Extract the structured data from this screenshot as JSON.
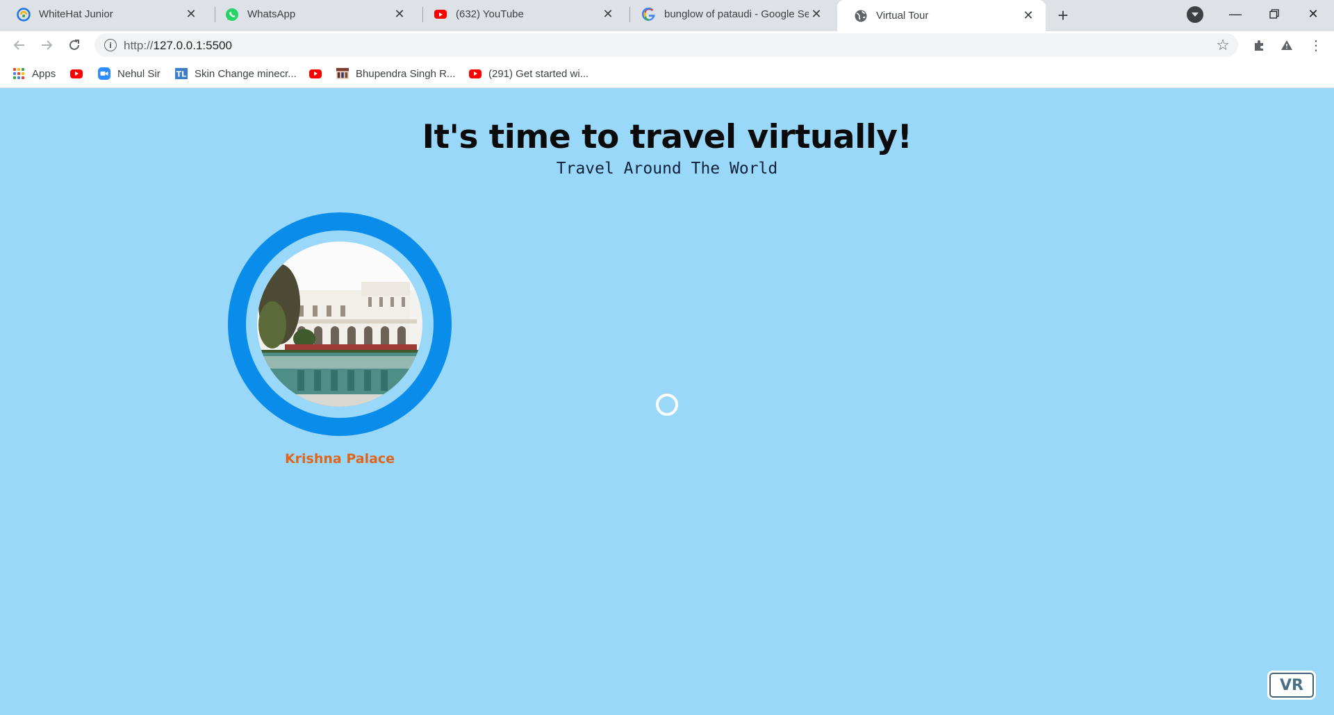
{
  "browser": {
    "tabs": [
      {
        "title": "WhiteHat Junior",
        "icon": "whitehat-icon"
      },
      {
        "title": "WhatsApp",
        "icon": "whatsapp-icon"
      },
      {
        "title": "(632) YouTube",
        "icon": "youtube-icon"
      },
      {
        "title": "bunglow of pataudi - Google Sea",
        "icon": "google-icon"
      },
      {
        "title": "Virtual Tour",
        "icon": "globe-icon",
        "active": true
      }
    ],
    "url": {
      "scheme": "http://",
      "host": "127.0.0.1:5500"
    },
    "bookmarks": [
      {
        "label": "Apps",
        "icon": "apps-grid-icon"
      },
      {
        "label": "",
        "icon": "youtube-icon"
      },
      {
        "label": "Nehul Sir",
        "icon": "zoom-icon"
      },
      {
        "label": "Skin Change minecr...",
        "icon": "tl-icon"
      },
      {
        "label": "",
        "icon": "youtube-icon"
      },
      {
        "label": "Bhupendra Singh R...",
        "icon": "site-thumb-icon"
      },
      {
        "label": "(291) Get started wi...",
        "icon": "youtube-icon"
      }
    ]
  },
  "page": {
    "headline": "It's time to travel virtually!",
    "subheadline": "Travel Around The World",
    "places": [
      {
        "label": "Krishna Palace",
        "image": "palace-photo"
      }
    ],
    "vr_button": "VR"
  },
  "colors": {
    "background": "#9ad8fa",
    "ring": "#0a8ceb",
    "place_label": "#e0651c",
    "tabstrip": "#dee1e6"
  }
}
